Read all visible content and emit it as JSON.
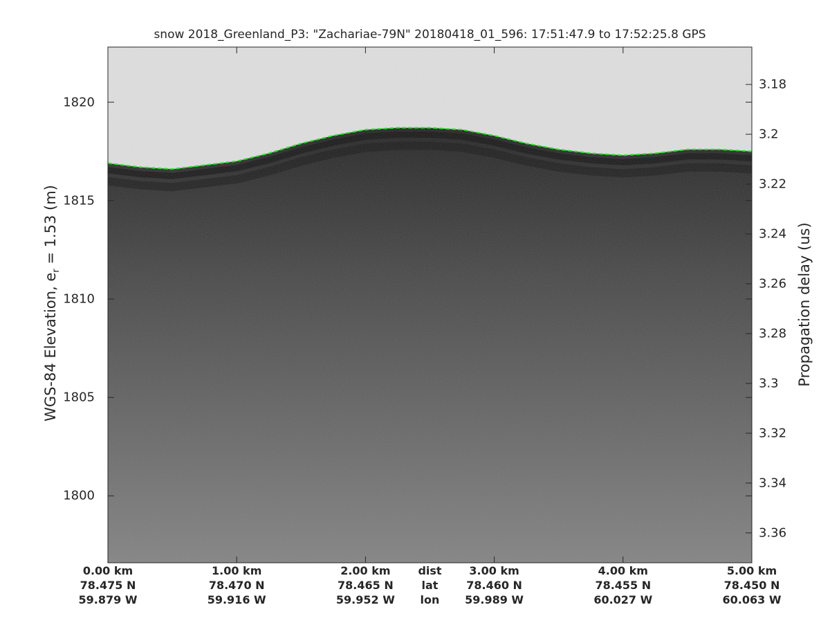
{
  "chart_data": {
    "type": "heatmap",
    "title": "snow 2018_Greenland_P3: \"Zachariae-79N\"  20180418_01_596: 17:51:47.9 to 17:52:25.8 GPS",
    "ylabel": "WGS-84 Elevation, e",
    "ylabel_sub": "r",
    "ylabel_suffix": " = 1.53 (m)",
    "y2label": "Propagation delay (us)",
    "ylim": [
      1796.6,
      1822.8
    ],
    "y_ticks": [
      "1820",
      "1815",
      "1810",
      "1805",
      "1800"
    ],
    "y_tick_values": [
      1820,
      1815,
      1810,
      1805,
      1800
    ],
    "y2_ticks": [
      "3.18",
      "3.2",
      "3.22",
      "3.24",
      "3.26",
      "3.28",
      "3.3",
      "3.32",
      "3.34",
      "3.36"
    ],
    "y2_tick_values": [
      3.18,
      3.2,
      3.22,
      3.24,
      3.26,
      3.28,
      3.3,
      3.32,
      3.34,
      3.36
    ],
    "y2lim": [
      3.165,
      3.372
    ],
    "xlim_km": [
      0,
      5
    ],
    "x_ticks": [
      {
        "km": 0,
        "dist": "0.00 km",
        "lat": "78.475 N",
        "lon": "59.879 W"
      },
      {
        "km": 1,
        "dist": "1.00 km",
        "lat": "78.470 N",
        "lon": "59.916 W"
      },
      {
        "km": 2,
        "dist": "2.00 km",
        "lat": "78.465 N",
        "lon": "59.952 W"
      },
      {
        "km": 3,
        "dist": "3.00 km",
        "lat": "78.460 N",
        "lon": "59.989 W"
      },
      {
        "km": 4,
        "dist": "4.00 km",
        "lat": "78.455 N",
        "lon": "60.027 W"
      },
      {
        "km": 5,
        "dist": "5.00 km",
        "lat": "78.450 N",
        "lon": "60.063 W"
      }
    ],
    "x_row_labels": {
      "km": 2.5,
      "dist": "dist",
      "lat": "lat",
      "lon": "lon"
    },
    "surface_pick": {
      "x_km": [
        0,
        0.25,
        0.5,
        0.75,
        1.0,
        1.25,
        1.5,
        1.75,
        2.0,
        2.25,
        2.5,
        2.75,
        3.0,
        3.25,
        3.5,
        3.75,
        4.0,
        4.25,
        4.5,
        4.75,
        5.0
      ],
      "elevation_m": [
        1816.9,
        1816.7,
        1816.6,
        1816.8,
        1817.0,
        1817.4,
        1817.9,
        1818.3,
        1818.6,
        1818.7,
        1818.7,
        1818.6,
        1818.3,
        1817.9,
        1817.6,
        1817.4,
        1817.3,
        1817.4,
        1817.6,
        1817.6,
        1817.5
      ]
    },
    "colors": {
      "air": "#dedede",
      "near_surface": "#2a2a2a",
      "deep": "#858585",
      "pick": "#22e322"
    },
    "grid": false,
    "legend": "none"
  }
}
